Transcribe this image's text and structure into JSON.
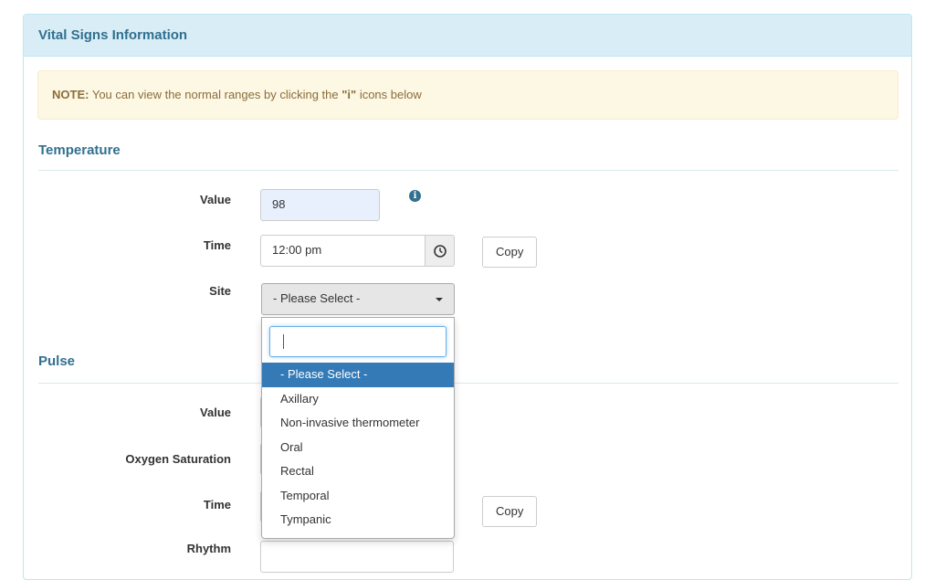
{
  "panel": {
    "title": "Vital Signs Information",
    "note_prefix": "NOTE:",
    "note_text_before": "You can view the normal ranges by clicking the ",
    "note_highlight": "\"i\"",
    "note_text_after": " icons below"
  },
  "temperature": {
    "title": "Temperature",
    "value_label": "Value",
    "value": "98",
    "time_label": "Time",
    "time_value": "12:00 pm",
    "copy_label": "Copy",
    "site_label": "Site",
    "site_selected": "- Please Select -",
    "site_options": [
      "- Please Select -",
      "Axillary",
      "Non-invasive thermometer",
      "Oral",
      "Rectal",
      "Temporal",
      "Tympanic"
    ]
  },
  "pulse": {
    "title": "Pulse",
    "value_label": "Value",
    "oxygen_label": "Oxygen Saturation",
    "time_label": "Time",
    "copy_label": "Copy",
    "rhythm_label": "Rhythm"
  },
  "icons": {
    "info": "info-icon",
    "clock": "clock-icon",
    "caret": "caret-down-icon"
  },
  "colors": {
    "heading_bg": "#d9edf7",
    "heading_text": "#31708f",
    "note_bg": "#fcf8e3",
    "note_text": "#8a6d3b",
    "selected_option": "#337ab7"
  }
}
